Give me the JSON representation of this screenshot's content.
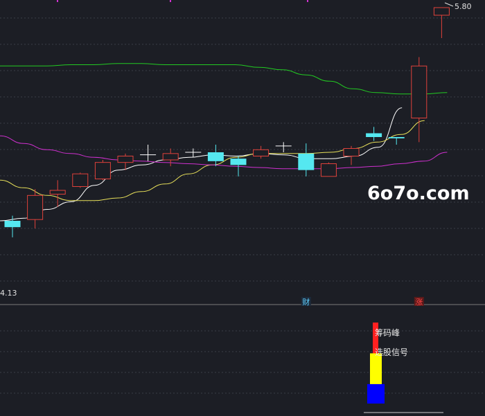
{
  "chart_data": [
    {
      "type": "candlestick",
      "title": "",
      "price_range": [
        3.6,
        6.0
      ],
      "low_label": "4.13",
      "high_label": "5.80",
      "grid": "horizontal dashed",
      "watermark": "6o7o.com",
      "markers": [
        {
          "text": "财",
          "candle_index": 13,
          "color": "#5fd0ff"
        },
        {
          "text": "涨",
          "candle_index": 18,
          "color": "#ff4444"
        }
      ],
      "candles": [
        {
          "open": 4.26,
          "high": 4.3,
          "low": 4.13,
          "close": 4.21
        },
        {
          "open": 4.27,
          "high": 4.51,
          "low": 4.2,
          "close": 4.46
        },
        {
          "open": 4.47,
          "high": 4.58,
          "low": 4.37,
          "close": 4.5
        },
        {
          "open": 4.53,
          "high": 4.64,
          "low": 4.52,
          "close": 4.63
        },
        {
          "open": 4.59,
          "high": 4.74,
          "low": 4.58,
          "close": 4.72
        },
        {
          "open": 4.72,
          "high": 4.79,
          "low": 4.66,
          "close": 4.77
        },
        {
          "open": 4.78,
          "high": 4.86,
          "low": 4.73,
          "close": 4.78
        },
        {
          "open": 4.74,
          "high": 4.83,
          "low": 4.69,
          "close": 4.79
        },
        {
          "open": 4.8,
          "high": 4.83,
          "low": 4.76,
          "close": 4.8
        },
        {
          "open": 4.8,
          "high": 4.86,
          "low": 4.69,
          "close": 4.73
        },
        {
          "open": 4.75,
          "high": 4.77,
          "low": 4.61,
          "close": 4.7
        },
        {
          "open": 4.77,
          "high": 4.85,
          "low": 4.75,
          "close": 4.82
        },
        {
          "open": 4.85,
          "high": 4.88,
          "low": 4.8,
          "close": 4.85
        },
        {
          "open": 4.79,
          "high": 4.87,
          "low": 4.61,
          "close": 4.66
        },
        {
          "open": 4.61,
          "high": 4.72,
          "low": 4.61,
          "close": 4.71
        },
        {
          "open": 4.77,
          "high": 4.85,
          "low": 4.7,
          "close": 4.83
        },
        {
          "open": 4.95,
          "high": 5.0,
          "low": 4.89,
          "close": 4.92
        },
        {
          "open": 4.92,
          "high": 4.92,
          "low": 4.86,
          "close": 4.91
        },
        {
          "open": 5.07,
          "high": 5.55,
          "low": 4.88,
          "close": 5.48
        },
        {
          "open": 5.88,
          "high": 5.94,
          "low": 5.7,
          "close": 5.94
        }
      ],
      "series": [
        {
          "color": "#ffffff",
          "values": [
            4.26,
            4.28,
            4.35,
            4.41,
            4.54,
            4.66,
            4.7,
            4.74,
            4.76,
            4.78,
            4.77,
            4.79,
            4.78,
            4.75,
            4.75,
            4.77,
            4.84,
            5.15
          ]
        },
        {
          "color": "#e8e05a",
          "values": [
            4.58,
            4.52,
            4.46,
            4.42,
            4.42,
            4.44,
            4.49,
            4.55,
            4.63,
            4.7,
            4.76,
            4.79,
            4.79,
            4.79,
            4.8,
            4.83,
            4.88,
            4.94,
            5.05
          ]
        },
        {
          "color": "#d030d0",
          "values": [
            4.93,
            4.87,
            4.82,
            4.79,
            4.76,
            4.74,
            4.73,
            4.72,
            4.71,
            4.7,
            4.69,
            4.68,
            4.67,
            4.67,
            4.67,
            4.68,
            4.69,
            4.71,
            4.73,
            4.8
          ]
        },
        {
          "color": "#22cc22",
          "values": [
            5.48,
            5.48,
            5.48,
            5.49,
            5.49,
            5.5,
            5.5,
            5.49,
            5.49,
            5.49,
            5.49,
            5.47,
            5.45,
            5.41,
            5.36,
            5.3,
            5.27,
            5.26,
            5.26,
            5.27
          ]
        }
      ]
    },
    {
      "type": "bar",
      "legend": [
        "筹码峰",
        "选股信号"
      ],
      "bars": [
        {
          "color": "#ff2020",
          "value": 1.0
        },
        {
          "color": "#ffff00",
          "value": 0.62
        },
        {
          "color": "#0000ff",
          "value": 0.24
        }
      ]
    }
  ]
}
